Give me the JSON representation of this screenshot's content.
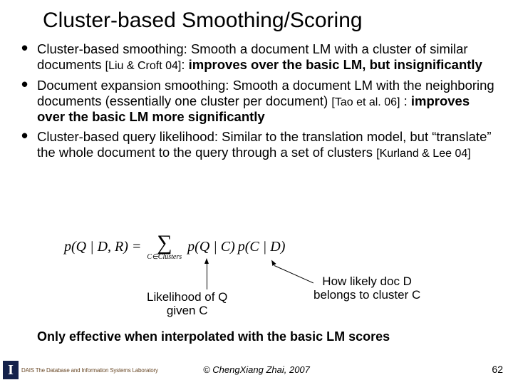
{
  "title": "Cluster-based Smoothing/Scoring",
  "bullets": [
    {
      "lead": "Cluster-based smoothing: Smooth a document LM with a cluster of similar documents ",
      "cite": "[Liu & Croft 04]",
      "tail": ": ",
      "bold": "improves over the basic LM, but insignificantly"
    },
    {
      "lead": "Document expansion smoothing: Smooth a document LM with the neighboring documents (essentially one cluster per document) ",
      "cite": "[Tao et al. 06]",
      "tail": " : ",
      "bold": "improves over the basic LM more significantly"
    },
    {
      "lead": "Cluster-based query likelihood: Similar to the translation model, but “translate” the whole document to the query through a set of clusters ",
      "cite": "[Kurland & Lee 04]",
      "tail": "",
      "bold": ""
    }
  ],
  "formula": {
    "lhs": "p(Q | D, R) =",
    "sigma_sub": "C∈Clusters",
    "term1": "p(Q | C)",
    "term2": "p(C | D)"
  },
  "annot_left_l1": "Likelihood of Q",
  "annot_left_l2": "given C",
  "annot_right_l1": "How likely doc D",
  "annot_right_l2": "belongs to cluster C",
  "footer_note": "Only effective when interpolated with the basic LM scores",
  "copyright": "© ChengXiang Zhai, 2007",
  "page": "62",
  "logo_I": "I",
  "logo_text": "DAIS The Database and Information Systems Laboratory"
}
